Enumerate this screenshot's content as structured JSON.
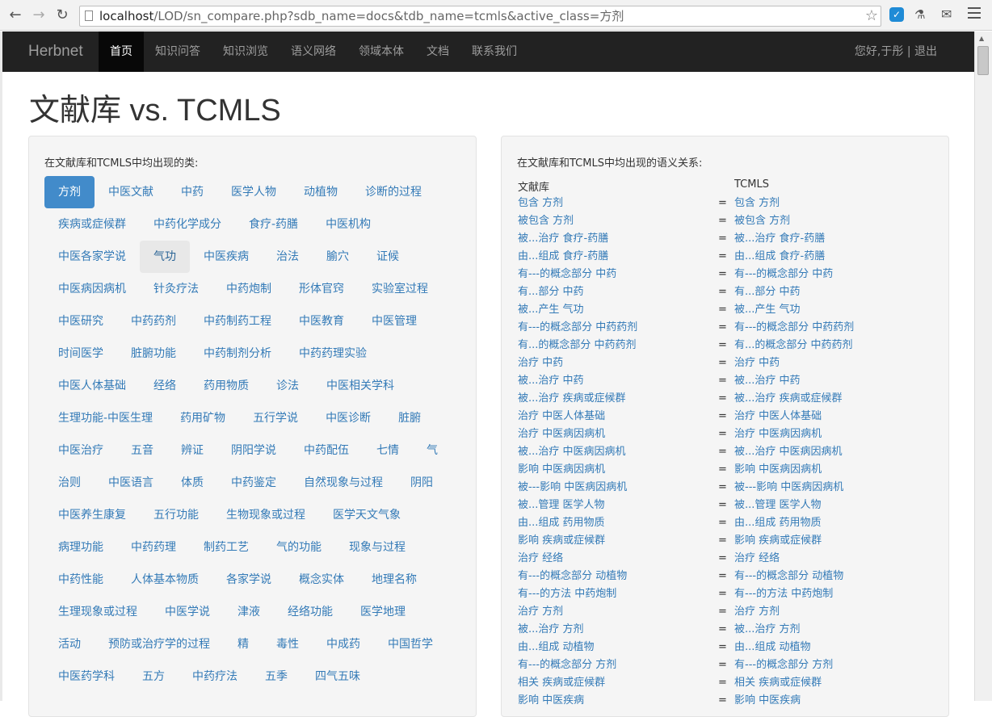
{
  "browser": {
    "url_host": "localhost",
    "url_path": "/LOD/sn_compare.php?sdb_name=docs&tdb_name=tcmls&active_class=方剂"
  },
  "navbar": {
    "brand": "Herbnet",
    "items": [
      "首页",
      "知识问答",
      "知识浏览",
      "语义网络",
      "领域本体",
      "文档",
      "联系我们"
    ],
    "active_index": 0,
    "user": "您好,于彤 | 退出"
  },
  "page": {
    "title": "文献库 vs. TCMLS"
  },
  "classes_panel": {
    "heading": "在文献库和TCMLS中均出现的类:",
    "active": "方剂",
    "hover": "气功",
    "items": [
      "方剂",
      "中医文献",
      "中药",
      "医学人物",
      "动植物",
      "诊断的过程",
      "疾病或症候群",
      "中药化学成分",
      "食疗-药膳",
      "中医机构",
      "中医各家学说",
      "气功",
      "中医疾病",
      "治法",
      "腧穴",
      "证候",
      "中医病因病机",
      "针灸疗法",
      "中药炮制",
      "形体官窍",
      "实验室过程",
      "中医研究",
      "中药药剂",
      "中药制药工程",
      "中医教育",
      "中医管理",
      "时间医学",
      "脏腑功能",
      "中药制剂分析",
      "中药药理实验",
      "中医人体基础",
      "经络",
      "药用物质",
      "诊法",
      "中医相关学科",
      "生理功能-中医生理",
      "药用矿物",
      "五行学说",
      "中医诊断",
      "脏腑",
      "中医治疗",
      "五音",
      "辨证",
      "阴阳学说",
      "中药配伍",
      "七情",
      "气",
      "治则",
      "中医语言",
      "体质",
      "中药鉴定",
      "自然现象与过程",
      "阴阳",
      "中医养生康复",
      "五行功能",
      "生物现象或过程",
      "医学天文气象",
      "病理功能",
      "中药药理",
      "制药工艺",
      "气的功能",
      "现象与过程",
      "中药性能",
      "人体基本物质",
      "各家学说",
      "概念实体",
      "地理名称",
      "生理现象或过程",
      "中医学说",
      "津液",
      "经络功能",
      "医学地理",
      "活动",
      "预防或治疗学的过程",
      "精",
      "毒性",
      "中成药",
      "中国哲学",
      "中医药学科",
      "五方",
      "中药疗法",
      "五季",
      "四气五味"
    ]
  },
  "relations_panel": {
    "heading": "在文献库和TCMLS中均出现的语义关系:",
    "col_left": "文献库",
    "col_right": "TCMLS",
    "eq": "=",
    "rows": [
      [
        "包含 方剂",
        "包含 方剂"
      ],
      [
        "被包含 方剂",
        "被包含 方剂"
      ],
      [
        "被...治疗 食疗-药膳",
        "被...治疗 食疗-药膳"
      ],
      [
        "由...组成 食疗-药膳",
        "由...组成 食疗-药膳"
      ],
      [
        "有---的概念部分 中药",
        "有---的概念部分 中药"
      ],
      [
        "有...部分 中药",
        "有...部分 中药"
      ],
      [
        "被...产生 气功",
        "被...产生 气功"
      ],
      [
        "有---的概念部分 中药药剂",
        "有---的概念部分 中药药剂"
      ],
      [
        "有...的概念部分 中药药剂",
        "有...的概念部分 中药药剂"
      ],
      [
        "治疗 中药",
        "治疗 中药"
      ],
      [
        "被...治疗 中药",
        "被...治疗 中药"
      ],
      [
        "被...治疗 疾病或症候群",
        "被...治疗 疾病或症候群"
      ],
      [
        "治疗 中医人体基础",
        "治疗 中医人体基础"
      ],
      [
        "治疗 中医病因病机",
        "治疗 中医病因病机"
      ],
      [
        "被...治疗 中医病因病机",
        "被...治疗 中医病因病机"
      ],
      [
        "影响 中医病因病机",
        "影响 中医病因病机"
      ],
      [
        "被---影响 中医病因病机",
        "被---影响 中医病因病机"
      ],
      [
        "被...管理 医学人物",
        "被...管理 医学人物"
      ],
      [
        "由...组成 药用物质",
        "由...组成 药用物质"
      ],
      [
        "影响 疾病或症候群",
        "影响 疾病或症候群"
      ],
      [
        "治疗 经络",
        "治疗 经络"
      ],
      [
        "有---的概念部分 动植物",
        "有---的概念部分 动植物"
      ],
      [
        "有---的方法 中药炮制",
        "有---的方法 中药炮制"
      ],
      [
        "治疗 方剂",
        "治疗 方剂"
      ],
      [
        "被...治疗 方剂",
        "被...治疗 方剂"
      ],
      [
        "由...组成 动植物",
        "由...组成 动植物"
      ],
      [
        "有---的概念部分 方剂",
        "有---的概念部分 方剂"
      ],
      [
        "相关 疾病或症候群",
        "相关 疾病或症候群"
      ],
      [
        "影响 中医疾病",
        "影响 中医疾病"
      ]
    ]
  }
}
